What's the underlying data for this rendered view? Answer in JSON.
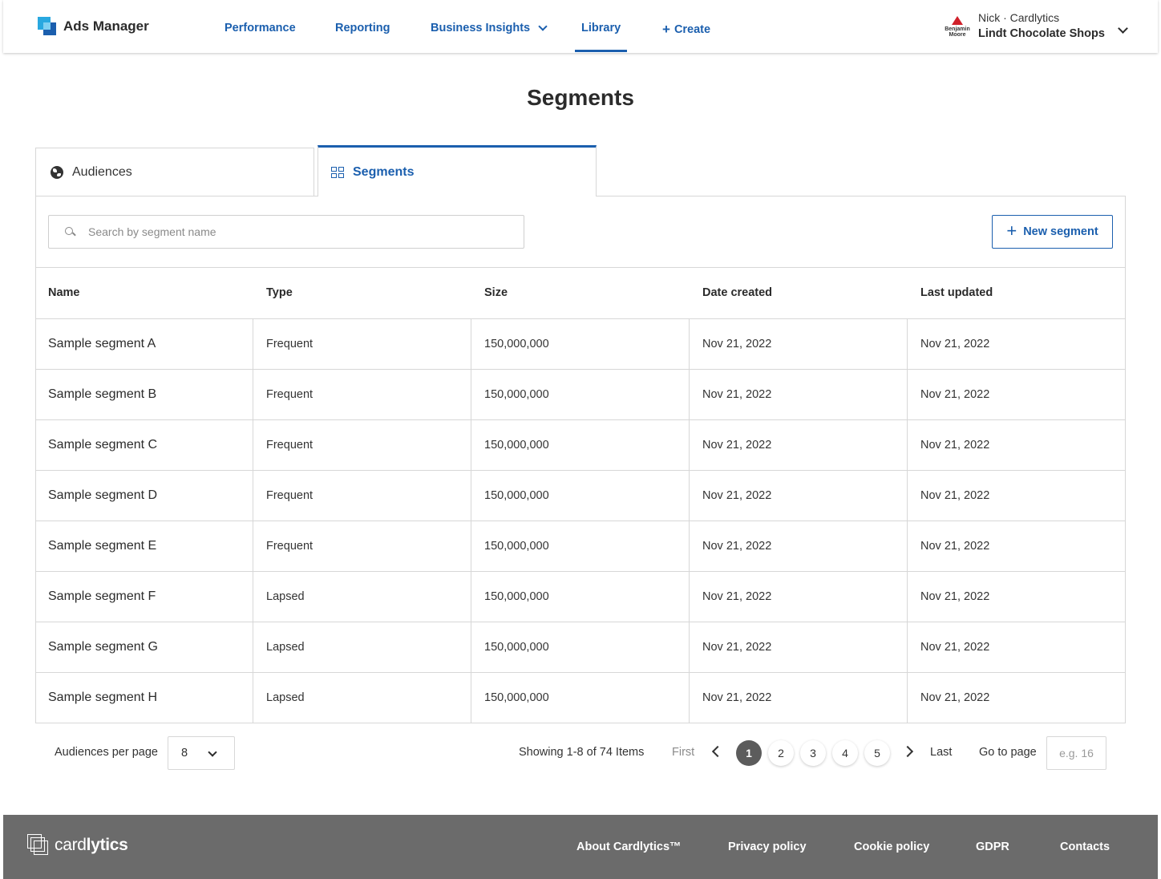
{
  "app": {
    "name": "Ads Manager"
  },
  "nav": {
    "items": [
      {
        "label": "Performance"
      },
      {
        "label": "Reporting"
      },
      {
        "label": "Business Insights"
      },
      {
        "label": "Library"
      },
      {
        "label": "Create"
      }
    ]
  },
  "account": {
    "logo_text": "Benjamin Moore",
    "user": "Nick · Cardlytics",
    "org": "Lindt Chocolate Shops"
  },
  "page": {
    "title": "Segments"
  },
  "tabs": [
    {
      "label": "Audiences",
      "icon": "globe-icon"
    },
    {
      "label": "Segments",
      "icon": "grid-icon",
      "active": true
    }
  ],
  "search": {
    "placeholder": "Search by segment name",
    "value": ""
  },
  "new_segment_label": "New segment",
  "table": {
    "headers": [
      "Name",
      "Type",
      "Size",
      "Date created",
      "Last updated"
    ],
    "rows": [
      [
        "Sample segment A",
        "Frequent",
        "150,000,000",
        "Nov 21, 2022",
        "Nov 21, 2022"
      ],
      [
        "Sample segment B",
        "Frequent",
        "150,000,000",
        "Nov 21, 2022",
        "Nov 21, 2022"
      ],
      [
        "Sample segment C",
        "Frequent",
        "150,000,000",
        "Nov 21, 2022",
        "Nov 21, 2022"
      ],
      [
        "Sample segment D",
        "Frequent",
        "150,000,000",
        "Nov 21, 2022",
        "Nov 21, 2022"
      ],
      [
        "Sample segment E",
        "Frequent",
        "150,000,000",
        "Nov 21, 2022",
        "Nov 21, 2022"
      ],
      [
        "Sample segment F",
        "Lapsed",
        "150,000,000",
        "Nov 21, 2022",
        "Nov 21, 2022"
      ],
      [
        "Sample segment G",
        "Lapsed",
        "150,000,000",
        "Nov 21, 2022",
        "Nov 21, 2022"
      ],
      [
        "Sample segment H",
        "Lapsed",
        "150,000,000",
        "Nov 21, 2022",
        "Nov 21, 2022"
      ]
    ]
  },
  "pagination": {
    "per_page_label": "Audiences per page",
    "per_page_value": "8",
    "showing": "Showing 1-8 of 74 Items",
    "first": "First",
    "last": "Last",
    "pages": [
      "1",
      "2",
      "3",
      "4",
      "5"
    ],
    "current_page": "1",
    "goto_label": "Go to page",
    "goto_placeholder": "e.g. 16"
  },
  "footer": {
    "logo_light": "card",
    "logo_bold": "lytics",
    "links": [
      "About Cardlytics™",
      "Privacy policy",
      "Cookie policy",
      "GDPR",
      "Contacts"
    ]
  },
  "colors": {
    "accent": "#1b5fae",
    "footer_bg": "#6b6b6b",
    "active_page": "#5c5c5c"
  }
}
